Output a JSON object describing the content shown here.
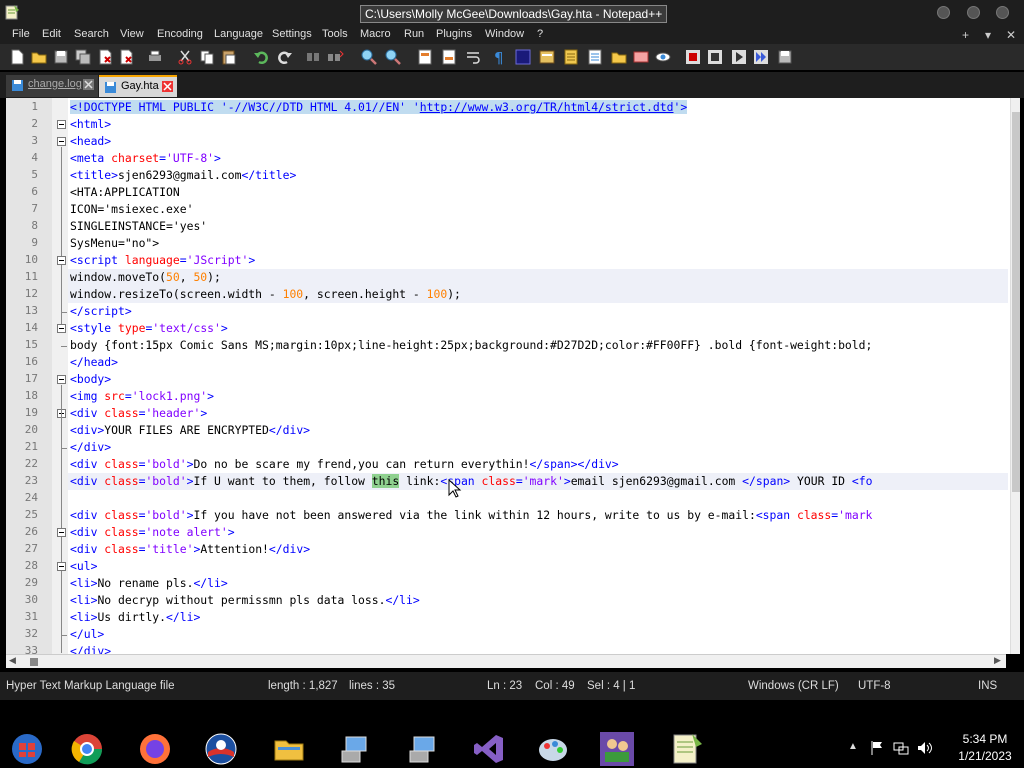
{
  "window": {
    "title": "C:\\Users\\Molly McGee\\Downloads\\Gay.hta - Notepad++"
  },
  "menu": [
    "File",
    "Edit",
    "Search",
    "View",
    "Encoding",
    "Language",
    "Settings",
    "Tools",
    "Macro",
    "Run",
    "Plugins",
    "Window",
    "?"
  ],
  "menu_right": {
    "plus": "+",
    "dropdown": "▾",
    "close": "✕"
  },
  "tabs": [
    {
      "label": "change.log",
      "active": false
    },
    {
      "label": "Gay.hta",
      "active": true
    }
  ],
  "editor": {
    "line_numbers": [
      "1",
      "2",
      "3",
      "4",
      "5",
      "6",
      "7",
      "8",
      "9",
      "10",
      "11",
      "12",
      "13",
      "14",
      "15",
      "16",
      "17",
      "18",
      "19",
      "20",
      "21",
      "22",
      "23",
      "24",
      "25",
      "26",
      "27",
      "28",
      "29",
      "30",
      "31",
      "32",
      "33"
    ]
  },
  "statusbar": {
    "filetype": "Hyper Text Markup Language file",
    "length": "length : 1,827",
    "lines": "lines : 35",
    "ln": "Ln : 23",
    "col": "Col : 49",
    "sel": "Sel : 4 | 1",
    "eol": "Windows (CR LF)",
    "encoding": "UTF-8",
    "mode": "INS"
  },
  "taskbar": {
    "time": "5:34 PM",
    "date": "1/21/2023"
  },
  "colors": {
    "tag": "#0000ff",
    "attribute": "#ff0000",
    "value": "#8000ff",
    "number": "#ff8000",
    "active_tab_accent": "#f5a300"
  }
}
